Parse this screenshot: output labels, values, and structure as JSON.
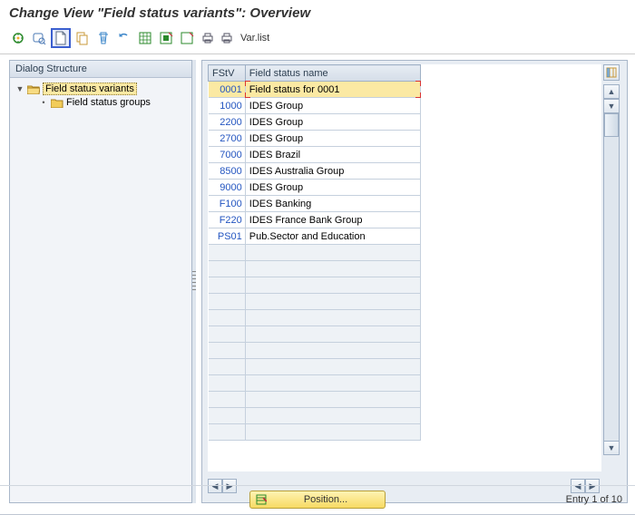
{
  "title": "Change View \"Field status variants\": Overview",
  "toolbar": {
    "varlist_label": "Var.list"
  },
  "tree": {
    "header": "Dialog Structure",
    "root_label": "Field status variants",
    "child_label": "Field status groups"
  },
  "table": {
    "col1": "FStV",
    "col2": "Field status name",
    "rows": [
      {
        "code": "0001",
        "name": "Field status for 0001",
        "selected": true
      },
      {
        "code": "1000",
        "name": "IDES Group"
      },
      {
        "code": "2200",
        "name": "IDES Group"
      },
      {
        "code": "2700",
        "name": "IDES Group"
      },
      {
        "code": "7000",
        "name": "IDES Brazil"
      },
      {
        "code": "8500",
        "name": "IDES Australia Group"
      },
      {
        "code": "9000",
        "name": "IDES Group"
      },
      {
        "code": "F100",
        "name": "IDES Banking"
      },
      {
        "code": "F220",
        "name": "IDES France Bank Group"
      },
      {
        "code": "PS01",
        "name": "Pub.Sector and Education"
      }
    ]
  },
  "footer": {
    "position_label": "Position...",
    "entry_text": "Entry 1 of 10"
  }
}
